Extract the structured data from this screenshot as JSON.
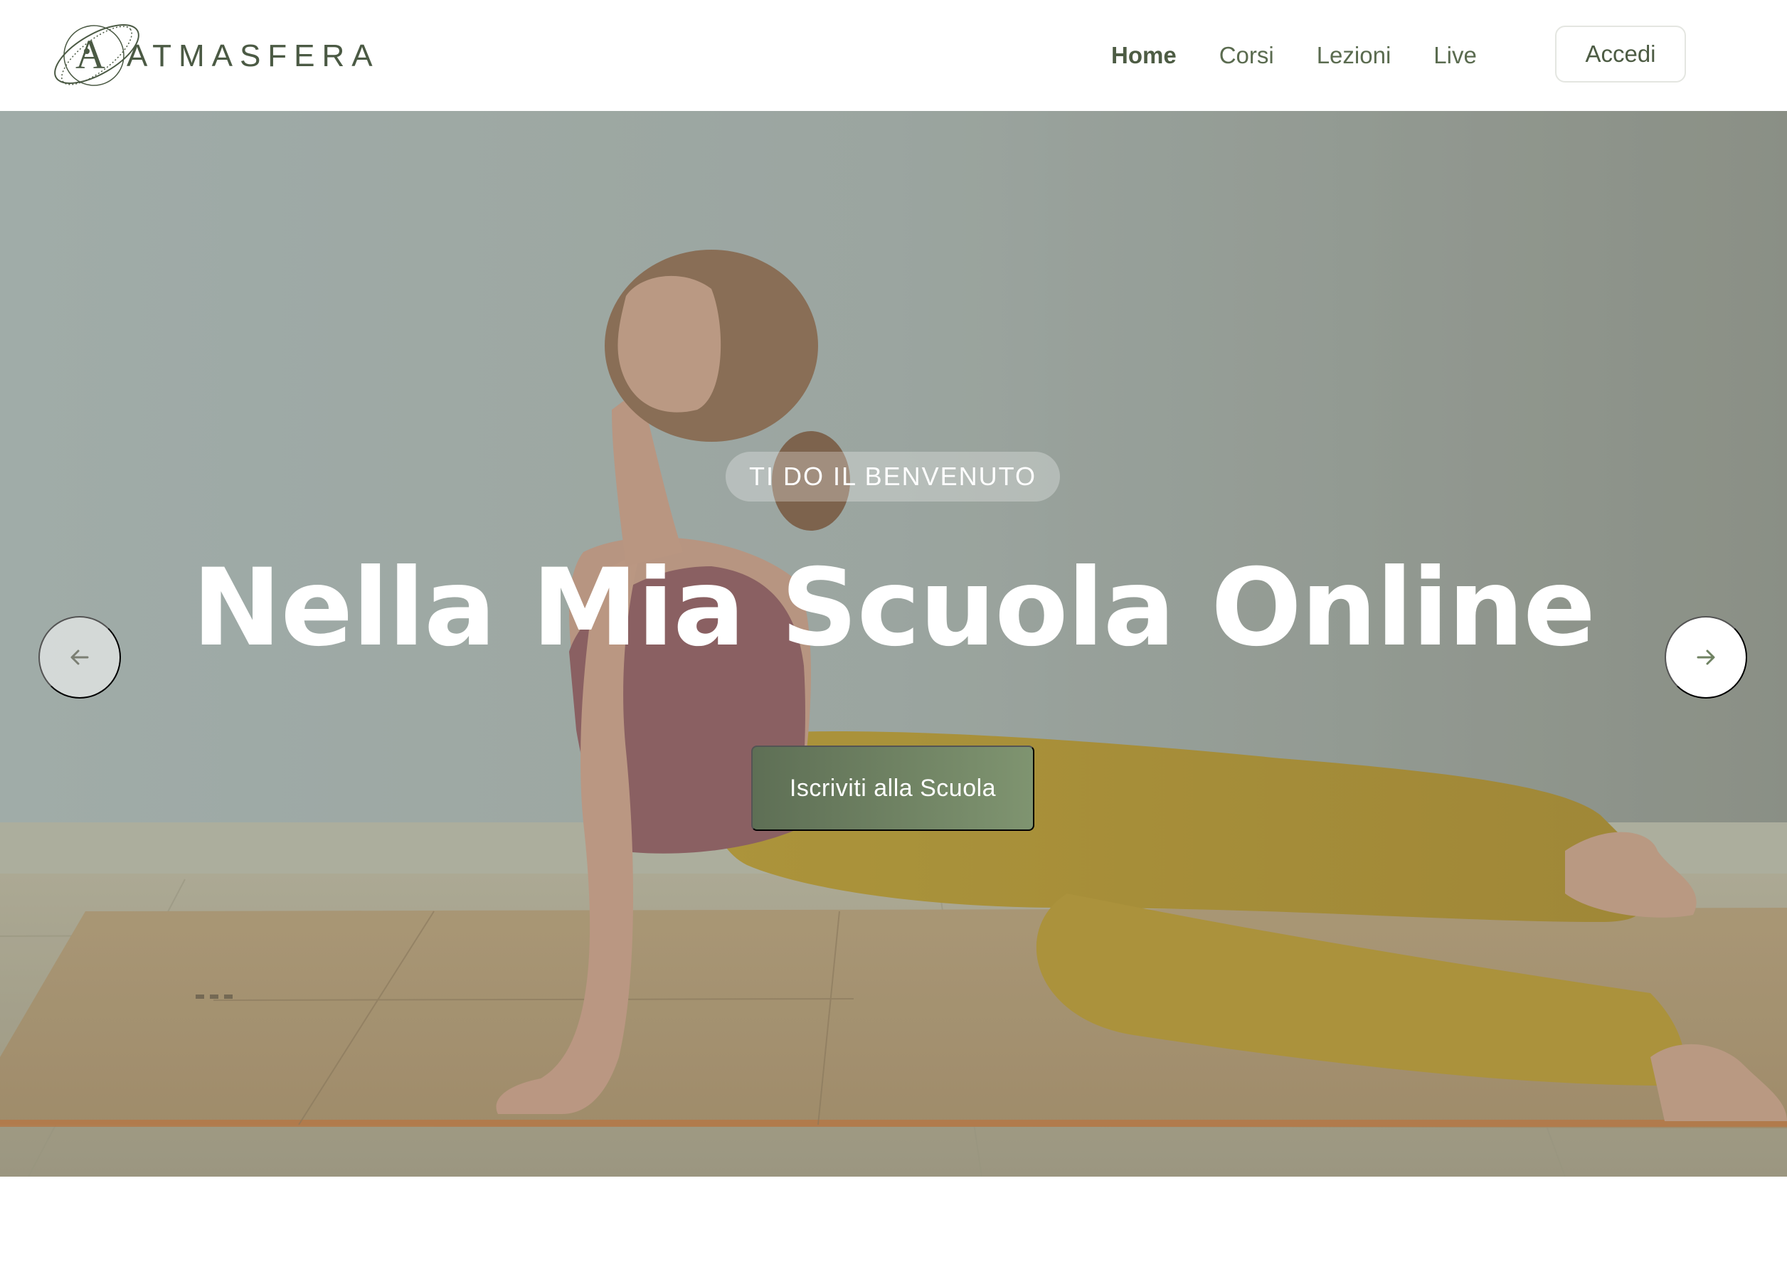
{
  "brand": {
    "name": "ATMASFERA",
    "color": "#4b5a44"
  },
  "nav": {
    "items": [
      {
        "label": "Home",
        "active": true
      },
      {
        "label": "Corsi",
        "active": false
      },
      {
        "label": "Lezioni",
        "active": false
      },
      {
        "label": "Live",
        "active": false
      }
    ],
    "login_label": "Accedi"
  },
  "hero": {
    "eyebrow": "TI DO IL BENVENUTO",
    "headline": "Nella Mia Scuola Online",
    "cta_label": "Iscriviti alla Scuola",
    "prev_icon": "arrow-left-icon",
    "next_icon": "arrow-right-icon"
  },
  "colors": {
    "accent": "#6f8262",
    "text_dark": "#4d5c44"
  }
}
